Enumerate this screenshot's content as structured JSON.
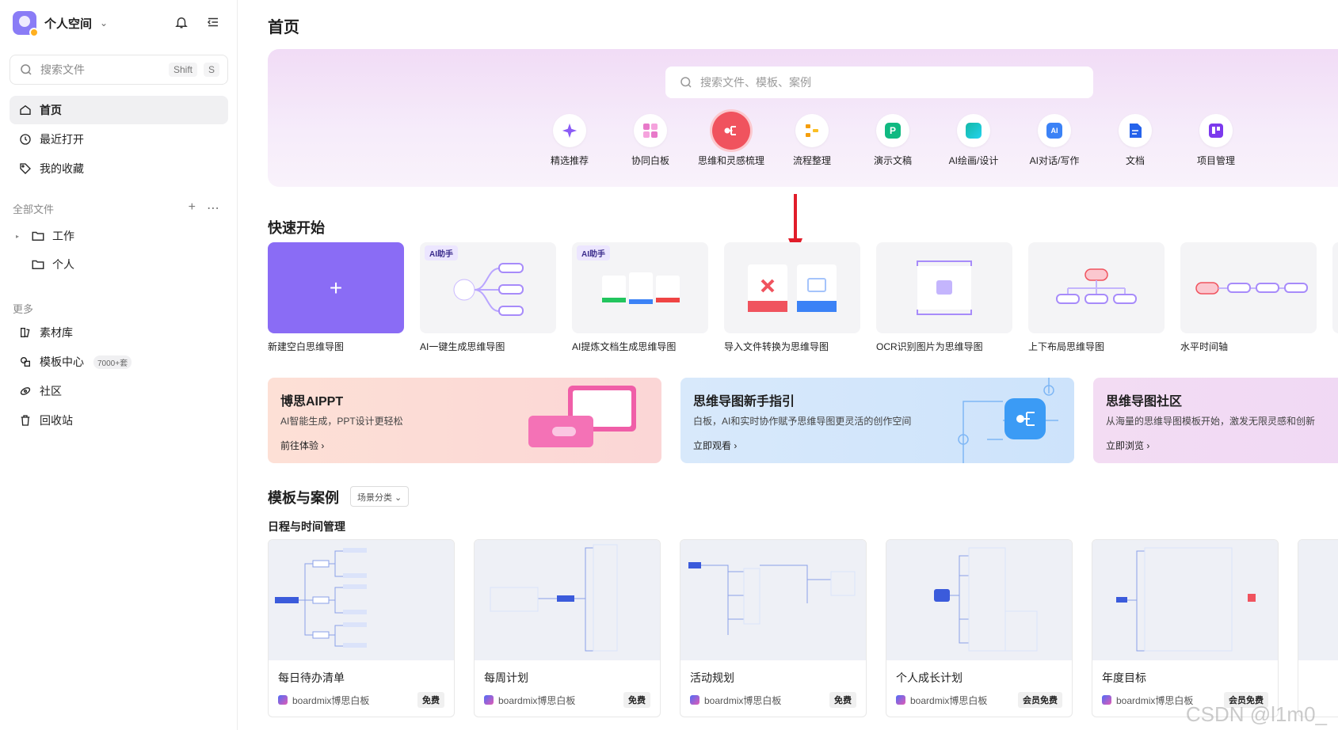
{
  "workspace": {
    "name": "个人空间"
  },
  "sidebar": {
    "search_placeholder": "搜索文件",
    "shortcut_1": "Shift",
    "shortcut_2": "S",
    "nav": [
      {
        "label": "首页",
        "icon": "home-icon"
      },
      {
        "label": "最近打开",
        "icon": "clock-icon"
      },
      {
        "label": "我的收藏",
        "icon": "tag-icon"
      }
    ],
    "files_title": "全部文件",
    "folders": [
      {
        "label": "工作"
      },
      {
        "label": "个人"
      }
    ],
    "more_title": "更多",
    "more": [
      {
        "label": "素材库",
        "icon": "library-icon"
      },
      {
        "label": "模板中心",
        "icon": "template-icon",
        "badge": "7000+套"
      },
      {
        "label": "社区",
        "icon": "community-icon"
      },
      {
        "label": "回收站",
        "icon": "trash-icon"
      }
    ]
  },
  "main": {
    "title": "首页",
    "hero_search_placeholder": "搜索文件、模板、案例",
    "categories": [
      {
        "label": "精选推荐",
        "color": "#8b5cf6"
      },
      {
        "label": "协同白板",
        "color": "#e879c9"
      },
      {
        "label": "思维和灵感梳理",
        "color": "#ffffff"
      },
      {
        "label": "流程整理",
        "color": "#f59e0b"
      },
      {
        "label": "演示文稿",
        "color": "#10b981"
      },
      {
        "label": "AI绘画/设计",
        "color": "#14b8a6"
      },
      {
        "label": "AI对话/写作",
        "color": "#3b82f6"
      },
      {
        "label": "文档",
        "color": "#2563eb"
      },
      {
        "label": "项目管理",
        "color": "#7c3aed"
      }
    ],
    "quick_start_title": "快速开始",
    "quick_start": [
      {
        "label": "新建空白思维导图"
      },
      {
        "label": "AI一键生成思维导图",
        "tag": "AI助手"
      },
      {
        "label": "AI提炼文档生成思维导图",
        "tag": "AI助手"
      },
      {
        "label": "导入文件转换为思维导图"
      },
      {
        "label": "OCR识别图片为思维导图"
      },
      {
        "label": "上下布局思维导图"
      },
      {
        "label": "水平时间轴"
      }
    ],
    "banners": [
      {
        "title": "博思AIPPT",
        "desc": "AI智能生成，PPT设计更轻松",
        "link": "前往体验 ›"
      },
      {
        "title": "思维导图新手指引",
        "desc": "白板，AI和实时协作赋予思维导图更灵活的创作空间",
        "link": "立即观看 ›"
      },
      {
        "title": "思维导图社区",
        "desc": "从海量的思维导图模板开始，激发无限灵感和创新",
        "link": "立即浏览 ›"
      }
    ],
    "templates_title": "模板与案例",
    "templates_filter": "场景分类 ⌄",
    "templates_subtitle": "日程与时间管理",
    "templates": [
      {
        "name": "每日待办清单",
        "brand": "boardmix博思白板",
        "badge": "免费"
      },
      {
        "name": "每周计划",
        "brand": "boardmix博思白板",
        "badge": "免费"
      },
      {
        "name": "活动规划",
        "brand": "boardmix博思白板",
        "badge": "免费"
      },
      {
        "name": "个人成长计划",
        "brand": "boardmix博思白板",
        "badge": "会员免费"
      },
      {
        "name": "年度目标",
        "brand": "boardmix博思白板",
        "badge": "会员免费"
      }
    ]
  },
  "watermark": "CSDN @l1m0_"
}
